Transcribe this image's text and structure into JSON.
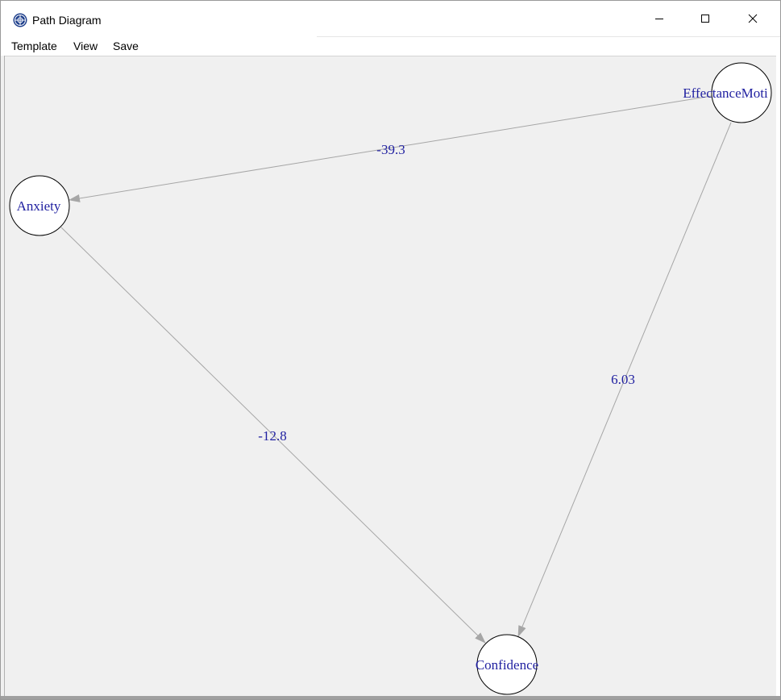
{
  "window": {
    "title": "Path Diagram",
    "minimize_glyph": "minimize-icon",
    "maximize_glyph": "maximize-icon",
    "close_glyph": "close-icon"
  },
  "menu": {
    "items": [
      "Template",
      "View",
      "Save"
    ]
  },
  "diagram": {
    "nodes": [
      {
        "id": "effectance",
        "label": "EffectanceMoti"
      },
      {
        "id": "anxiety",
        "label": "Anxiety"
      },
      {
        "id": "confidence",
        "label": "Confidence"
      }
    ],
    "edges": [
      {
        "from": "effectance",
        "to": "anxiety",
        "label": "-39.3"
      },
      {
        "from": "anxiety",
        "to": "confidence",
        "label": "-12.8"
      },
      {
        "from": "effectance",
        "to": "confidence",
        "label": "6.03"
      }
    ],
    "colors": {
      "canvas": "#f0f0f0",
      "edge": "#a6a6a6",
      "label": "#1f1fa0",
      "node_fill": "#ffffff",
      "node_stroke": "#000000"
    }
  }
}
